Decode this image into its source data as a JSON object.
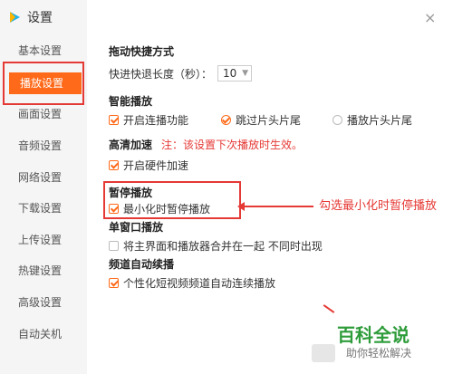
{
  "app": {
    "title": "设置",
    "close_symbol": "×"
  },
  "sidebar": {
    "items": [
      {
        "label": "基本设置"
      },
      {
        "label": "播放设置",
        "active": true
      },
      {
        "label": "画面设置"
      },
      {
        "label": "音频设置"
      },
      {
        "label": "网络设置"
      },
      {
        "label": "下载设置"
      },
      {
        "label": "上传设置"
      },
      {
        "label": "热键设置"
      },
      {
        "label": "高级设置"
      },
      {
        "label": "自动关机"
      }
    ]
  },
  "main": {
    "seek": {
      "title": "拖动快捷方式",
      "length_label": "快进快退长度（秒）：",
      "length_value": "10"
    },
    "smart_play": {
      "title": "智能播放",
      "options": [
        {
          "label": "开启连播功能",
          "type": "checkbox",
          "checked": true
        },
        {
          "label": "跳过片头片尾",
          "type": "radio",
          "checked": true
        },
        {
          "label": "播放片头片尾",
          "type": "radio",
          "checked": false
        }
      ]
    },
    "hd_accel": {
      "title": "高清加速",
      "note": "注：该设置下次播放时生效。",
      "option": {
        "label": "开启硬件加速",
        "checked": true
      }
    },
    "pause": {
      "title": "暂停播放",
      "option": {
        "label": "最小化时暂停播放",
        "checked": true
      }
    },
    "single_window": {
      "title": "单窗口播放",
      "option": {
        "label": "将主界面和播放器合并在一起 不同时出现",
        "checked": false
      }
    },
    "channel_auto": {
      "title": "频道自动续播",
      "option": {
        "label": "个性化短视频频道自动连续播放",
        "checked": true
      }
    }
  },
  "annotation": {
    "text": "勾选最小化时暂停播放"
  },
  "watermark": {
    "brand": "百科全说",
    "sub": "助你轻松解决"
  },
  "colors": {
    "accent": "#ff6a1a",
    "annotation": "#e53935",
    "brand_green": "#2e9c3a"
  }
}
